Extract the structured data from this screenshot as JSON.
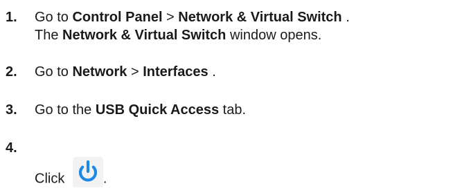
{
  "steps": [
    {
      "number": "1.",
      "parts": [
        "Go to ",
        "Control Panel",
        " > ",
        "Network & Virtual Switch",
        " ."
      ],
      "sub_parts": [
        "The ",
        "Network & Virtual Switch",
        " window opens."
      ]
    },
    {
      "number": "2.",
      "parts": [
        "Go to ",
        "Network",
        " > ",
        "Interfaces",
        " ."
      ]
    },
    {
      "number": "3.",
      "parts": [
        "Go to the ",
        "USB Quick Access",
        " tab."
      ]
    },
    {
      "number": "4.",
      "parts": [
        "Click ",
        "."
      ],
      "icon": "power-icon"
    }
  ],
  "colors": {
    "text": "#1a1a1a",
    "icon_blue": "#1e88e5",
    "icon_bg": "#f2f2f2"
  }
}
